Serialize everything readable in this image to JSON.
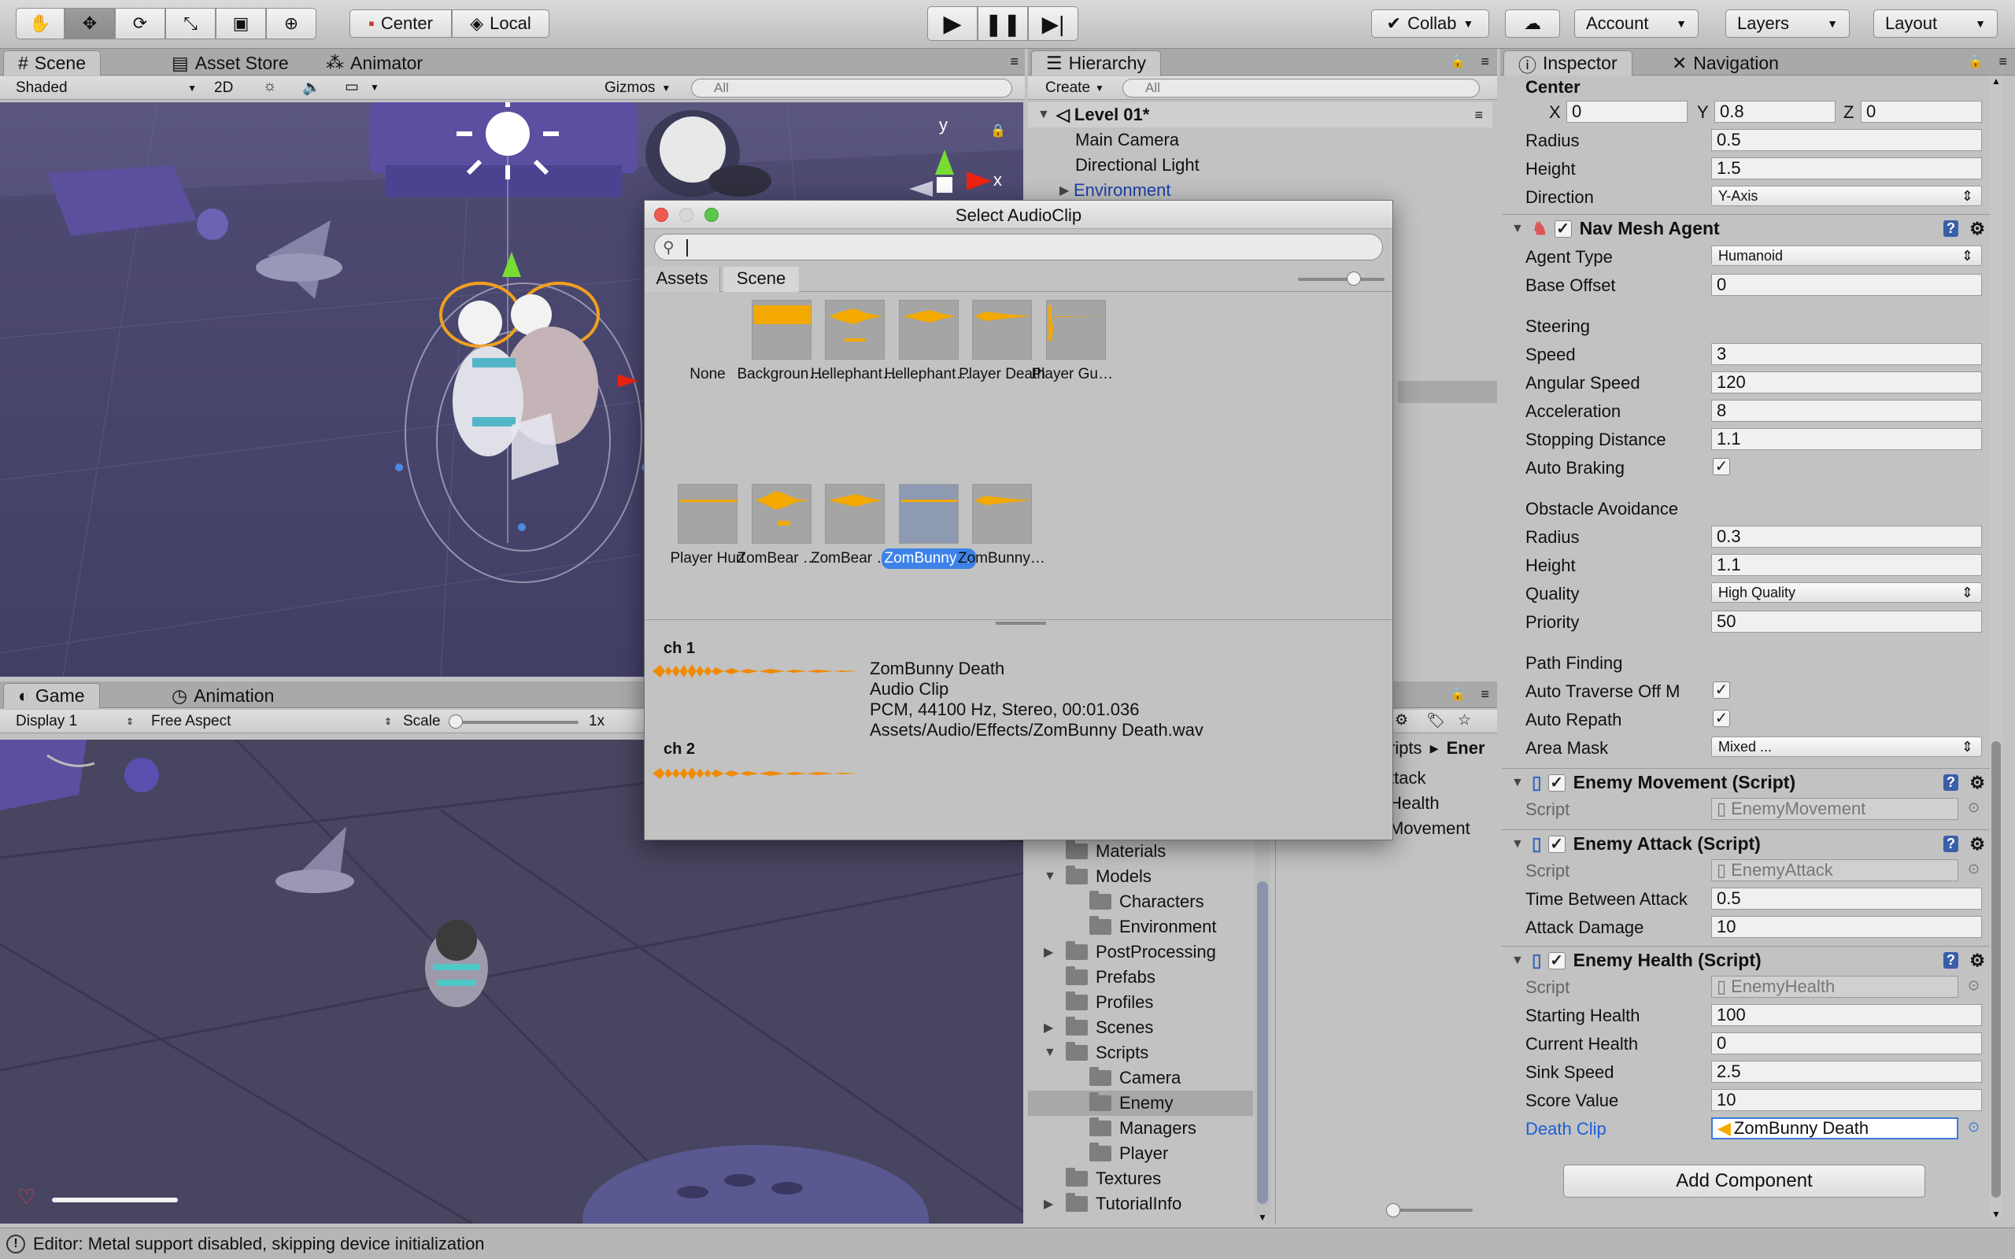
{
  "toolbar": {
    "pivot_center": "Center",
    "pivot_local": "Local",
    "collab": "Collab",
    "account": "Account",
    "layers": "Layers",
    "layout": "Layout"
  },
  "scene_panel": {
    "tabs": [
      "Scene",
      "Asset Store",
      "Animator"
    ],
    "shading": "Shaded",
    "mode_2d": "2D",
    "gizmos": "Gizmos",
    "search_placeholder": "All",
    "axis_y": "y",
    "axis_x": "x"
  },
  "game_panel": {
    "tabs": [
      "Game",
      "Animation"
    ],
    "display": "Display 1",
    "aspect": "Free Aspect",
    "scale_label": "Scale",
    "scale_value": "1x"
  },
  "hierarchy": {
    "tab": "Hierarchy",
    "create": "Create",
    "search_placeholder": "All",
    "scene_name": "Level 01*",
    "items": [
      "Main Camera",
      "Directional Light",
      "Environment"
    ]
  },
  "project": {
    "breadcrumb": [
      "ripts",
      "Ener"
    ],
    "files": [
      "ttack",
      "Health",
      "Movement"
    ],
    "folders": [
      {
        "name": "Materials",
        "indent": 1,
        "arrow": ""
      },
      {
        "name": "Models",
        "indent": 1,
        "arrow": "▼"
      },
      {
        "name": "Characters",
        "indent": 2,
        "arrow": ""
      },
      {
        "name": "Environment",
        "indent": 2,
        "arrow": ""
      },
      {
        "name": "PostProcessing",
        "indent": 1,
        "arrow": "▶"
      },
      {
        "name": "Prefabs",
        "indent": 1,
        "arrow": ""
      },
      {
        "name": "Profiles",
        "indent": 1,
        "arrow": ""
      },
      {
        "name": "Scenes",
        "indent": 1,
        "arrow": "▶"
      },
      {
        "name": "Scripts",
        "indent": 1,
        "arrow": "▼"
      },
      {
        "name": "Camera",
        "indent": 2,
        "arrow": ""
      },
      {
        "name": "Enemy",
        "indent": 2,
        "arrow": "",
        "selected": true
      },
      {
        "name": "Managers",
        "indent": 2,
        "arrow": ""
      },
      {
        "name": "Player",
        "indent": 2,
        "arrow": ""
      },
      {
        "name": "Textures",
        "indent": 1,
        "arrow": ""
      },
      {
        "name": "TutorialInfo",
        "indent": 1,
        "arrow": "▶"
      }
    ]
  },
  "dialog": {
    "title": "Select AudioClip",
    "tabs": [
      "Assets",
      "Scene"
    ],
    "clips": [
      "None",
      "Background…",
      "Hellephant D…",
      "Hellephant …",
      "Player Death",
      "Player GunS…",
      "Player Hurt",
      "ZomBear Dea…",
      "ZomBear Hurt",
      "ZomBunny D…",
      "ZomBunny H…"
    ],
    "selected_index": 9,
    "channels": [
      "ch 1",
      "ch 2"
    ],
    "info": {
      "name": "ZomBunny Death",
      "type": "Audio Clip",
      "format": "PCM, 44100 Hz, Stereo, 00:01.036",
      "path": "Assets/Audio/Effects/ZomBunny Death.wav"
    }
  },
  "inspector": {
    "tabs": [
      "Inspector",
      "Navigation"
    ],
    "center_label": "Center",
    "center": {
      "x_label": "X",
      "x": "0",
      "y_label": "Y",
      "y": "0.8",
      "z_label": "Z",
      "z": "0"
    },
    "capsule": {
      "radius_label": "Radius",
      "radius": "0.5",
      "height_label": "Height",
      "height": "1.5",
      "direction_label": "Direction",
      "direction": "Y-Axis"
    },
    "nav_mesh_agent": {
      "title": "Nav Mesh Agent",
      "agent_type_label": "Agent Type",
      "agent_type": "Humanoid",
      "base_offset_label": "Base Offset",
      "base_offset": "0",
      "steering_label": "Steering",
      "speed_label": "Speed",
      "speed": "3",
      "angular_speed_label": "Angular Speed",
      "angular_speed": "120",
      "acceleration_label": "Acceleration",
      "acceleration": "8",
      "stopping_distance_label": "Stopping Distance",
      "stopping_distance": "1.1",
      "auto_braking_label": "Auto Braking",
      "obstacle_label": "Obstacle Avoidance",
      "radius_label": "Radius",
      "radius": "0.3",
      "height_label": "Height",
      "height": "1.1",
      "quality_label": "Quality",
      "quality": "High Quality",
      "priority_label": "Priority",
      "priority": "50",
      "path_label": "Path Finding",
      "auto_traverse_label": "Auto Traverse Off M",
      "auto_repath_label": "Auto Repath",
      "area_mask_label": "Area Mask",
      "area_mask": "Mixed ..."
    },
    "enemy_movement": {
      "title": "Enemy Movement (Script)",
      "script_label": "Script",
      "script": "EnemyMovement"
    },
    "enemy_attack": {
      "title": "Enemy Attack (Script)",
      "script_label": "Script",
      "script": "EnemyAttack",
      "tba_label": "Time Between Attack",
      "tba": "0.5",
      "damage_label": "Attack Damage",
      "damage": "10"
    },
    "enemy_health": {
      "title": "Enemy Health (Script)",
      "script_label": "Script",
      "script": "EnemyHealth",
      "start_label": "Starting Health",
      "start": "100",
      "current_label": "Current Health",
      "current": "0",
      "sink_label": "Sink Speed",
      "sink": "2.5",
      "score_label": "Score Value",
      "score": "10",
      "clip_label": "Death Clip",
      "clip": "ZomBunny Death"
    },
    "add_component": "Add Component"
  },
  "status": {
    "message": "Editor: Metal support disabled, skipping device initialization"
  },
  "colors": {
    "accent": "#3b7ae0",
    "waveform": "#f3a900",
    "selection": "#3d82e8"
  }
}
